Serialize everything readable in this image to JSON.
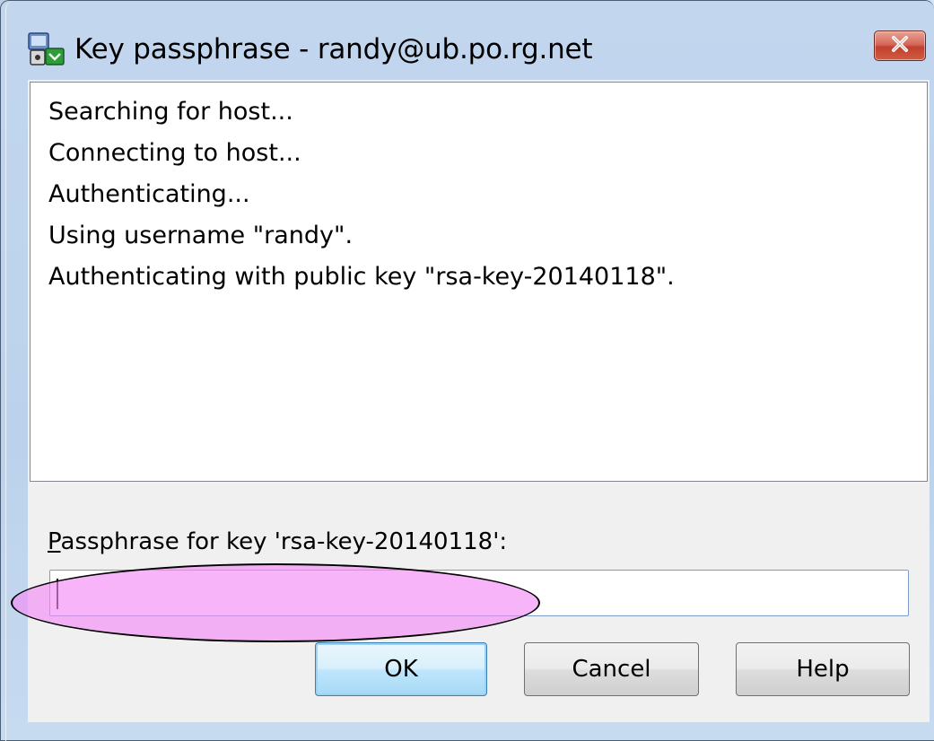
{
  "window": {
    "title": "Key passphrase - randy@ub.po.rg.net"
  },
  "log": {
    "lines": [
      "Searching for host...",
      "Connecting to host...",
      "Authenticating...",
      "Using username \"randy\".",
      "Authenticating with public key \"rsa-key-20140118\"."
    ]
  },
  "passphrase": {
    "label_access_key": "P",
    "label_rest": "assphrase for key 'rsa-key-20140118':",
    "value": ""
  },
  "buttons": {
    "ok": "OK",
    "cancel": "Cancel",
    "help": "Help"
  },
  "icons": {
    "app": "computer-key-icon",
    "close": "close-icon"
  },
  "colors": {
    "close_button": "#c7503b",
    "highlight": "#f58cf5",
    "default_button_border": "#3c7fb1"
  }
}
